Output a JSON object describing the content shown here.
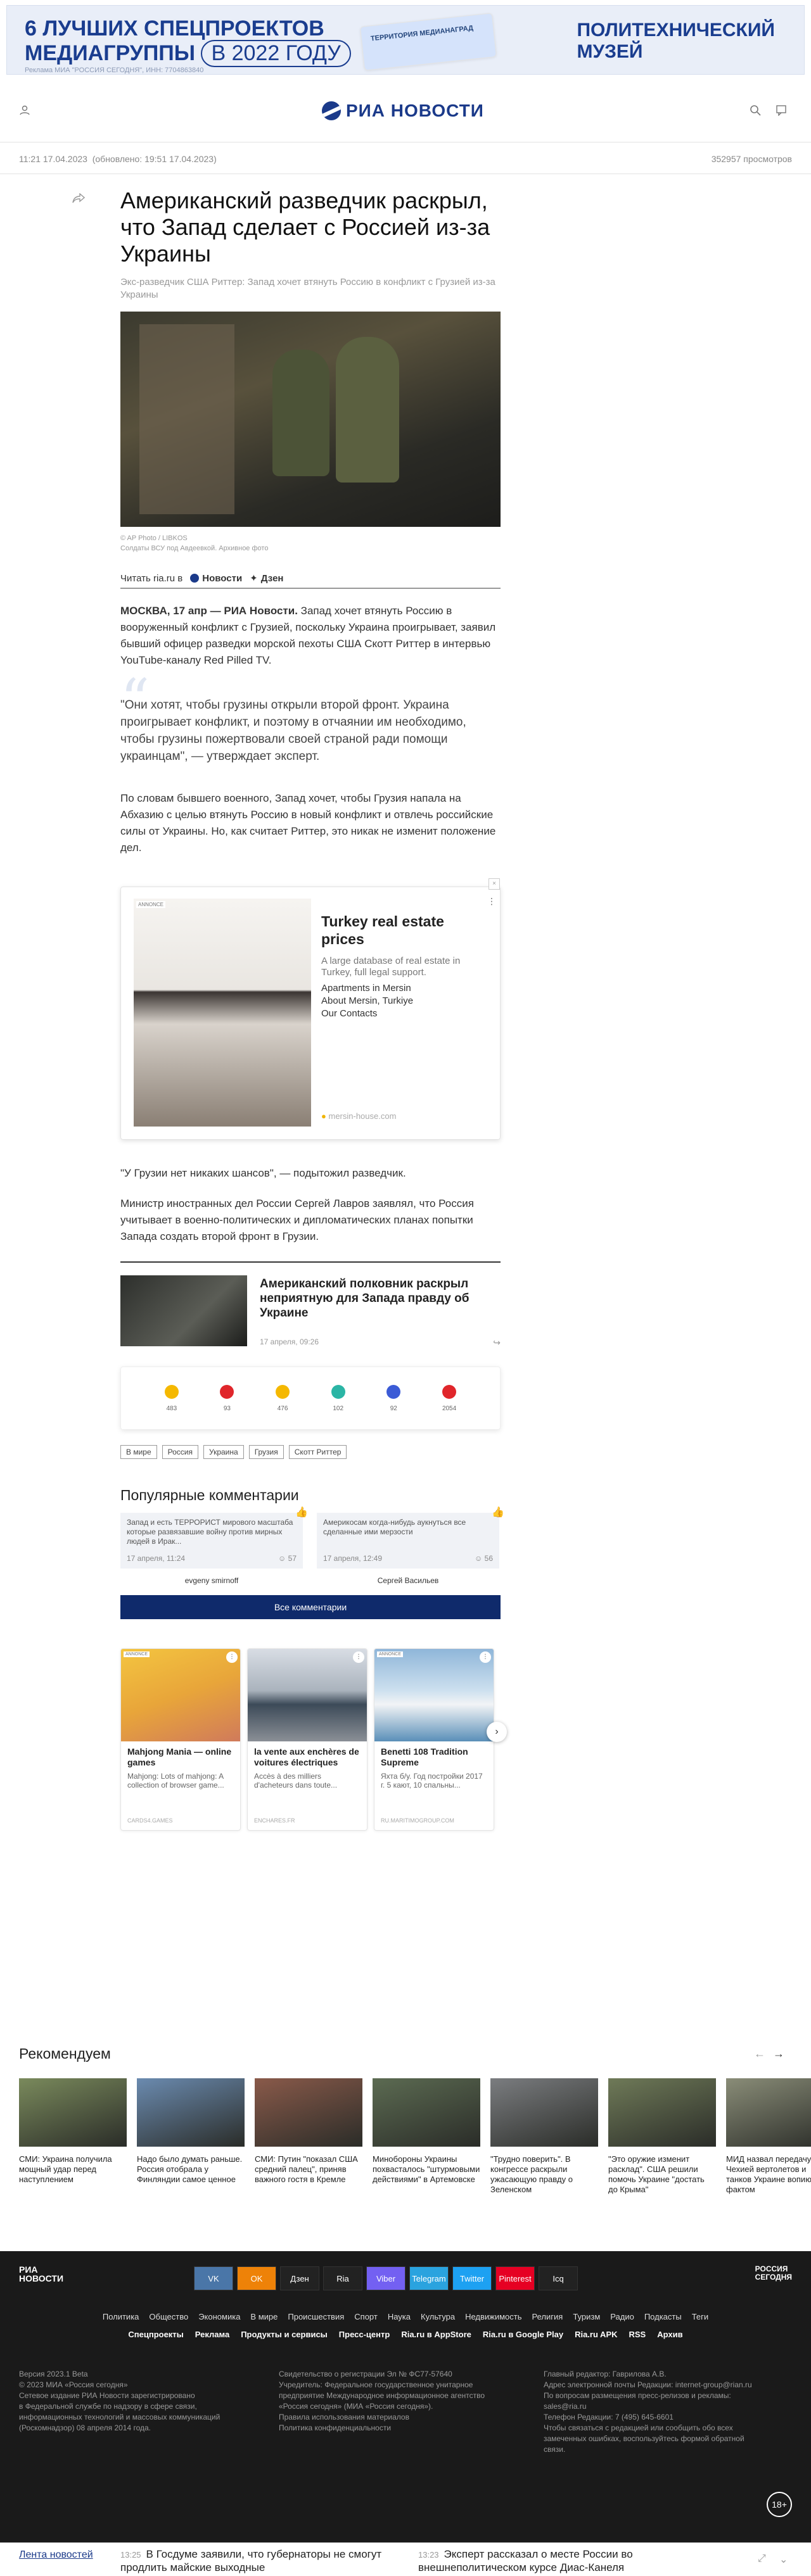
{
  "topad": {
    "line1": "6 ЛУЧШИХ СПЕЦПРОЕКТОВ",
    "line2a": "МЕДИАГРУППЫ",
    "line2b": "В 2022 ГОДУ",
    "card": "ТЕРРИТОРИЯ МЕДИАНАГРАД",
    "right1": "ПОЛИТЕХНИЧЕСКИЙ",
    "right2": "МУЗЕЙ",
    "mark": "Реклама МИА \"РОССИЯ СЕГОДНЯ\", ИНН: 7704863840"
  },
  "header": {
    "logo": "РИА НОВОСТИ"
  },
  "meta": {
    "time": "11:21 17.04.2023",
    "updated": "(обновлено: 19:51 17.04.2023)",
    "views": "352957 просмотров"
  },
  "article": {
    "title": "Американский разведчик раскрыл, что Запад сделает с Россией из-за Украины",
    "subtitle": "Экс-разведчик США Риттер: Запад хочет втянуть Россию в конфликт с Грузией из-за Украины",
    "credit": "© AP Photo / LIBKOS",
    "caption": "Солдаты ВСУ под Авдеевкой. Архивное фото",
    "readin": "Читать ria.ru в",
    "readin_news": "Новости",
    "readin_dzen": "Дзен",
    "p1_lead": "МОСКВА, 17 апр — РИА Новости.",
    "p1": "Запад хочет втянуть Россию в вооруженный конфликт с Грузией, поскольку Украина проигрывает, заявил бывший офицер разведки морской пехоты США Скотт Риттер в интервью YouTube-каналу Red Pilled TV.",
    "quote": "\"Они хотят, чтобы грузины открыли второй фронт. Украина проигрывает конфликт, и поэтому в отчаянии им необходимо, чтобы грузины пожертвовали своей страной ради помощи украинцам\", — утверждает эксперт.",
    "p2": "По словам бывшего военного, Запад хочет, чтобы Грузия напала на Абхазию с целью втянуть Россию в новый конфликт и отвлечь российские силы от Украины. Но, как считает Риттер, это никак не изменит положение дел.",
    "p3": "\"У Грузии нет никаких шансов\", — подытожил разведчик.",
    "p4": "Министр иностранных дел России Сергей Лавров заявлял, что Россия учитывает в военно-политических и дипломатических планах попытки Запада создать второй фронт в Грузии."
  },
  "ad": {
    "label": "ANNONCE",
    "close": "×",
    "title": "Turkey real estate prices",
    "desc": "A large database of real estate in Turkey, full legal support.",
    "link1": "Apartments in Mersin",
    "link2": "About Mersin, Turkiye",
    "link3": "Our Contacts",
    "url": "mersin-house.com"
  },
  "related": {
    "title": "Американский полковник раскрыл неприятную для Запада правду об Украине",
    "date": "17 апреля, 09:26"
  },
  "emotions": [
    {
      "icon": "like-icon",
      "count": "483",
      "color": "#f5b800"
    },
    {
      "icon": "dislike-icon",
      "count": "93",
      "color": "#e0262b"
    },
    {
      "icon": "laugh-icon",
      "count": "476",
      "color": "#f5b800"
    },
    {
      "icon": "surprise-icon",
      "count": "102",
      "color": "#2bb5a5"
    },
    {
      "icon": "sad-icon",
      "count": "92",
      "color": "#3b5bd6"
    },
    {
      "icon": "angry-icon",
      "count": "2054",
      "color": "#e0262b"
    }
  ],
  "tags": [
    "В мире",
    "Россия",
    "Украина",
    "Грузия",
    "Скотт Риттер"
  ],
  "comments": {
    "heading": "Популярные комментарии",
    "items": [
      {
        "text": "Запад и есть ТЕРРОРИСТ мирового масштаба которые развязавшие войну против мирных людей в Ирак...",
        "date": "17 апреля, 11:24",
        "count": "57",
        "user": "evgeny smirnoff"
      },
      {
        "text": "Америкосам когда-нибудь аукнуться все сделанные ими мерзости",
        "date": "17 апреля, 12:49",
        "count": "56",
        "user": "Сергей Васильев"
      }
    ],
    "all": "Все комментарии"
  },
  "promo": [
    {
      "title": "Mahjong Mania — online games",
      "desc": "Mahjong: Lots of mahjong: A collection of browser game...",
      "domain": "CARDS4.GAMES",
      "ad": "ANNONCE"
    },
    {
      "title": "la vente aux enchères de voitures électriques",
      "desc": "Accès à des milliers d'acheteurs dans toute...",
      "domain": "ENCHARES.FR",
      "ad": ""
    },
    {
      "title": "Benetti 108 Tradition Supreme",
      "desc": "Яхта б/у. Год постройки 2017 г. 5 кают, 10 спальны...",
      "domain": "RU.MARITIMOGROUP.COM",
      "ad": "ANNONCE"
    }
  ],
  "recommended": {
    "heading": "Рекомендуем",
    "items": [
      "СМИ: Украина получила мощный удар перед наступлением",
      "Надо было думать раньше. Россия отобрала у Финляндии самое ценное",
      "СМИ: Путин \"показал США средний палец\", приняв важного гостя в Кремле",
      "Минобороны Украины похвасталось \"штурмовыми действиями\" в Артемовске",
      "\"Трудно поверить\". В конгрессе раскрыли ужасающую правду о Зеленском",
      "\"Это оружие изменит расклад\". США решили помочь Украине \"достать до Крыма\"",
      "МИД назвал передачу Чехией вертолетов и танков Украине вопиющим фактом"
    ]
  },
  "footer": {
    "logo1": "РИА",
    "logo2": "НОВОСТИ",
    "rs1": "РОССИЯ",
    "rs2": "СЕГОДНЯ",
    "social": [
      "VK",
      "OK",
      "Дзен",
      "Ria",
      "Viber",
      "Telegram",
      "Twitter",
      "Pinterest",
      "Icq"
    ],
    "nav1": [
      "Политика",
      "Общество",
      "Экономика",
      "В мире",
      "Происшествия",
      "Спорт",
      "Наука",
      "Культура",
      "Недвижимость",
      "Религия",
      "Туризм",
      "Радио",
      "Подкасты",
      "Теги"
    ],
    "nav2": [
      "Спецпроекты",
      "Реклама",
      "Продукты и сервисы",
      "Пресс-центр",
      "Ria.ru в AppStore",
      "Ria.ru в Google Play",
      "Ria.ru APK",
      "RSS",
      "Архив"
    ],
    "col1": [
      "Версия 2023.1 Beta",
      "© 2023 МИА «Россия сегодня»",
      "Сетевое издание РИА Новости зарегистрировано",
      "в Федеральной службе по надзору в сфере связи,",
      "информационных технологий и массовых коммуникаций",
      "(Роскомнадзор) 08 апреля 2014 года."
    ],
    "col2": [
      "Свидетельство о регистрации Эл № ФС77-57640",
      "Учредитель: Федеральное государственное унитарное",
      "предприятие Международное информационное агентство",
      "«Россия сегодня» (МИА «Россия сегодня»).",
      "Правила использования материалов",
      "Политика конфиденциальности"
    ],
    "col3": [
      "Главный редактор: Гаврилова А.В.",
      "Адрес электронной почты Редакции: internet-group@rian.ru",
      "По вопросам размещения пресс-релизов и рекламы:",
      "sales@ria.ru",
      "Телефон Редакции: 7 (495) 645-6601",
      "Чтобы связаться с редакцией или сообщить обо всех",
      "замеченных ошибках, воспользуйтесь формой обратной",
      "связи."
    ],
    "age": "18+"
  },
  "ticker": {
    "label": "Лента новостей",
    "items": [
      {
        "time": "13:25",
        "text": "В Госдуме заявили, что губернаторы не смогут продлить майские выходные"
      },
      {
        "time": "13:23",
        "text": "Эксперт рассказал о месте России во внешнеполитическом курсе Диас-Канеля"
      }
    ]
  }
}
